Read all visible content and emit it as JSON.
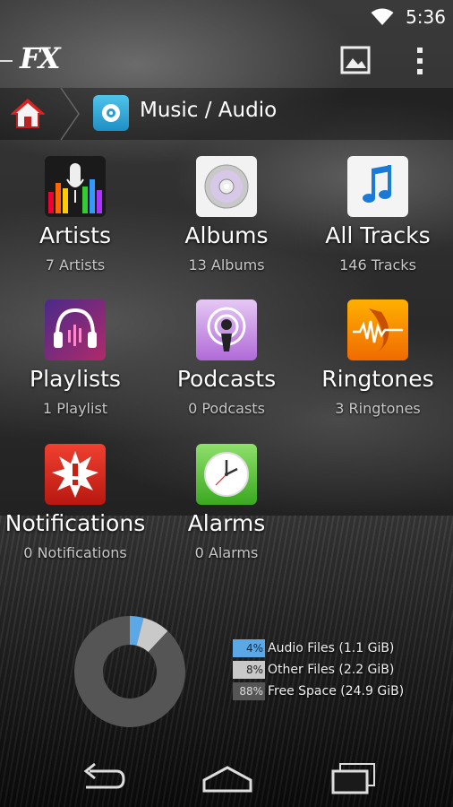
{
  "status_bar": {
    "time": "5:36"
  },
  "app_bar": {
    "logo": "FX",
    "image_icon": "image-icon",
    "menu_icon": "overflow-menu-icon"
  },
  "breadcrumb": {
    "home_icon": "home-icon",
    "label": "Music / Audio"
  },
  "categories": [
    {
      "label": "Artists",
      "count": "7 Artists"
    },
    {
      "label": "Albums",
      "count": "13 Albums"
    },
    {
      "label": "All Tracks",
      "count": "146 Tracks"
    },
    {
      "label": "Playlists",
      "count": "1 Playlist"
    },
    {
      "label": "Podcasts",
      "count": "0 Podcasts"
    },
    {
      "label": "Ringtones",
      "count": "3 Ringtones"
    },
    {
      "label": "Notifications",
      "count": "0 Notifications"
    },
    {
      "label": "Alarms",
      "count": "0 Alarms"
    }
  ],
  "storage": {
    "items": [
      {
        "percent": "4%",
        "label": "Audio Files (1.1 GiB)",
        "value": 4,
        "color": "#5aa9e6"
      },
      {
        "percent": "8%",
        "label": "Other Files (2.2 GiB)",
        "value": 8,
        "color": "#c9c9c9"
      },
      {
        "percent": "88%",
        "label": "Free Space (24.9 GiB)",
        "value": 88,
        "color": "#555555"
      }
    ]
  },
  "nav_bar": {
    "back": "back-icon",
    "home": "home-nav-icon",
    "recents": "recents-icon"
  }
}
